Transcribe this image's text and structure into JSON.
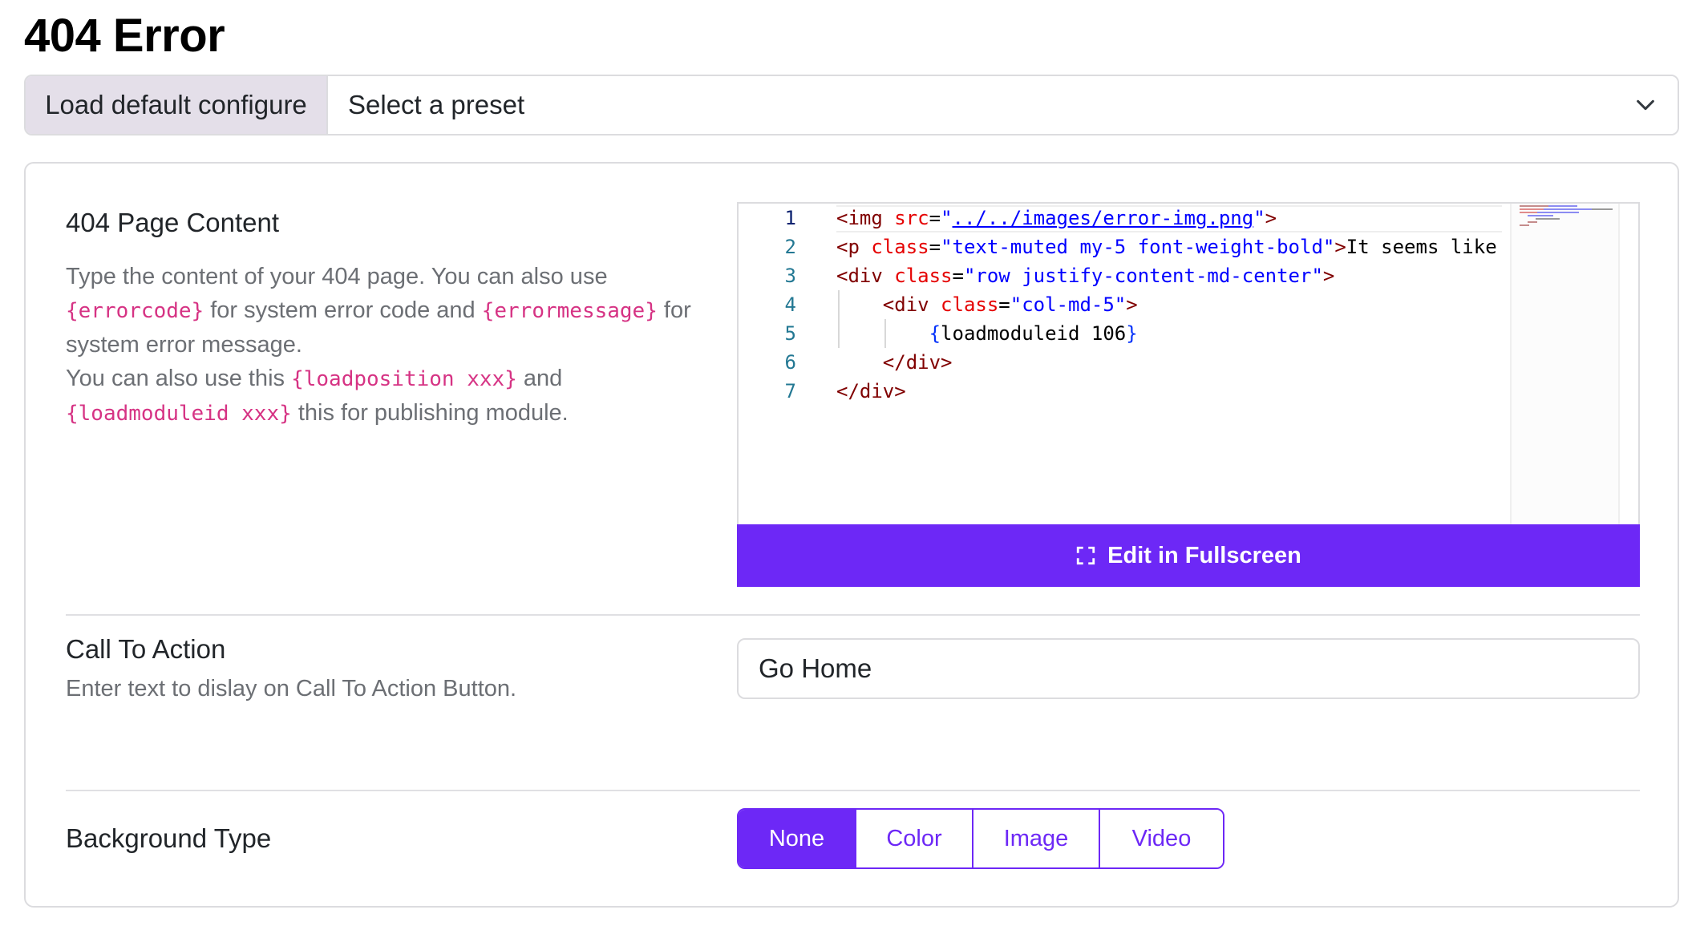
{
  "page": {
    "title": "404 Error"
  },
  "preset": {
    "load_default_label": "Load default configure",
    "select_placeholder": "Select a preset"
  },
  "content_section": {
    "title": "404 Page Content",
    "desc_part1": "Type the content of your 404 page. You can also use ",
    "code_errorcode": "{errorcode}",
    "desc_part2": " for system error code and ",
    "code_errormessage": "{errormessage}",
    "desc_part3": " for system error message.",
    "desc_part4": "You can also use this ",
    "code_loadposition": "{loadposition xxx}",
    "desc_part5": " and ",
    "code_loadmoduleid": "{loadmoduleid xxx}",
    "desc_part6": " this for publishing module."
  },
  "editor": {
    "line_numbers": [
      "1",
      "2",
      "3",
      "4",
      "5",
      "6",
      "7"
    ],
    "lines": [
      "<img src=\"../../images/error-img.png\">",
      "<p class=\"text-muted my-5 font-weight-bold\">It seems like",
      "<div class=\"row justify-content-md-center\">",
      "    <div class=\"col-md-5\">",
      "        {loadmoduleid 106}",
      "    </div>",
      "</div>"
    ],
    "fullscreen_label": "Edit in Fullscreen"
  },
  "cta_section": {
    "title": "Call To Action",
    "description": "Enter text to dislay on Call To Action Button.",
    "input_value": "Go Home"
  },
  "background_section": {
    "title": "Background Type",
    "options": [
      "None",
      "Color",
      "Image",
      "Video"
    ],
    "selected": "None"
  },
  "colors": {
    "accent": "#6d28f6",
    "code_pink": "#d63384",
    "muted_text": "#6c6f74",
    "border": "#dcdcdf"
  }
}
